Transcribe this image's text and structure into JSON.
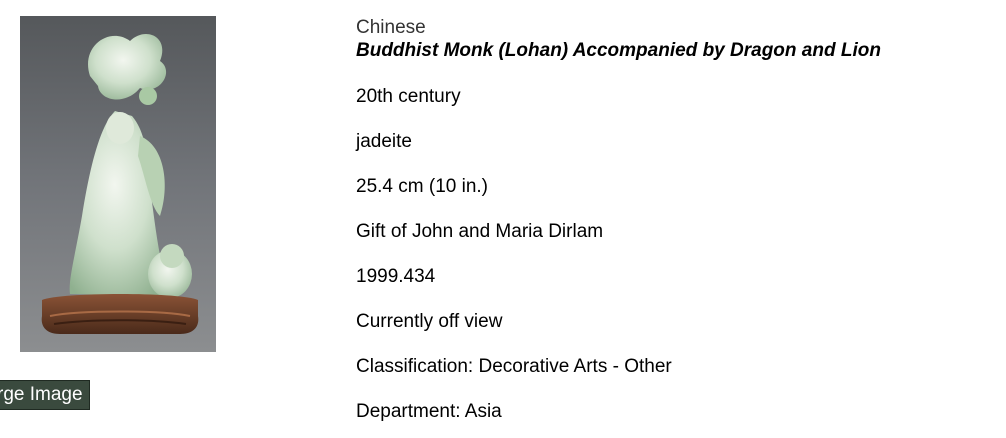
{
  "artwork": {
    "culture": "Chinese",
    "title": "Buddhist Monk (Lohan) Accompanied by Dragon and Lion",
    "date": "20th century",
    "medium": "jadeite",
    "dimensions": "25.4 cm (10 in.)",
    "credit_line": "Gift of John and Maria Dirlam",
    "accession_number": "1999.434",
    "location_status": "Currently off view",
    "classification": "Classification: Decorative Arts - Other",
    "department": "Department: Asia"
  },
  "image": {
    "large_image_label": "rge Image"
  },
  "colors": {
    "button_bg": "#3a4a3e",
    "photo_bg": "#6c6f72",
    "jade": "#c9dcc8",
    "wood_stand": "#6b3f2a"
  }
}
